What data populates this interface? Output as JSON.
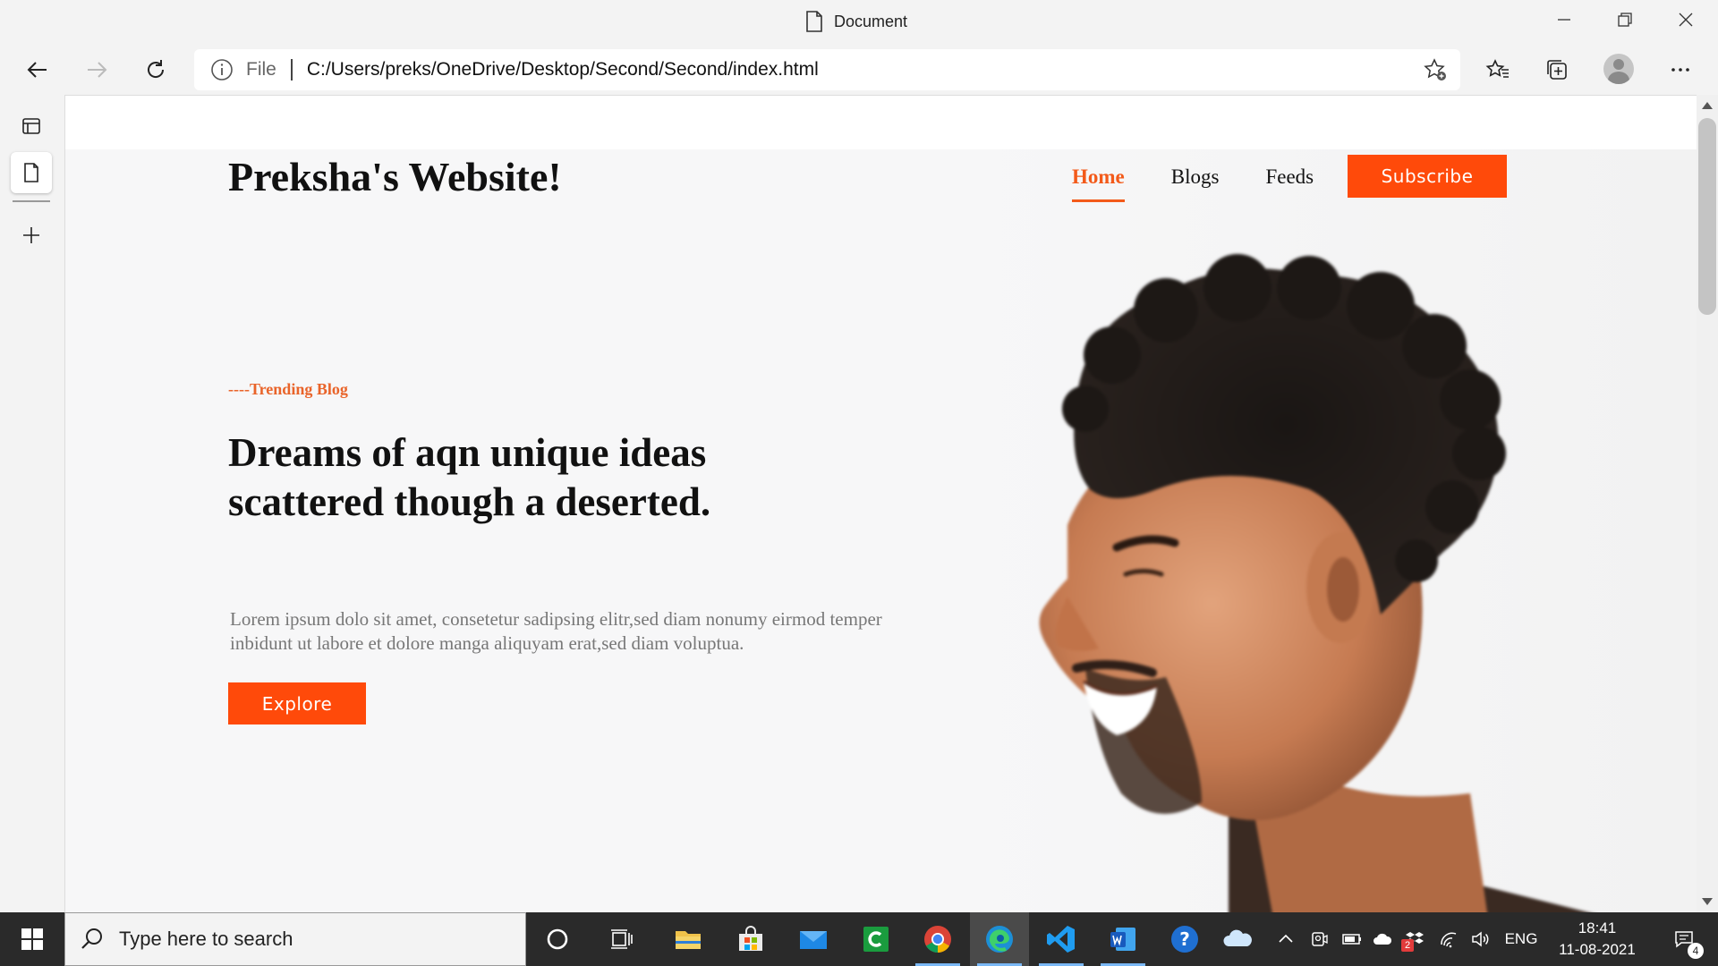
{
  "window": {
    "title": "Document",
    "icons": {
      "doc": "document-icon",
      "minimize": "minimize-icon",
      "restore": "restore-icon",
      "close": "close-icon"
    }
  },
  "toolbar": {
    "file_label": "File",
    "url": "C:/Users/preks/OneDrive/Desktop/Second/Second/index.html",
    "icons": [
      "back-icon",
      "forward-icon",
      "refresh-icon",
      "info-icon",
      "add-favorite-icon",
      "favorites-icon",
      "collections-icon",
      "profile-avatar",
      "more-icon"
    ]
  },
  "vertical_tabs": {
    "icons": [
      "tab-actions-icon",
      "document-tab-icon",
      "new-tab-icon"
    ]
  },
  "site": {
    "logo": "Preksha's Website!",
    "nav": [
      {
        "label": "Home",
        "active": true
      },
      {
        "label": "Blogs",
        "active": false
      },
      {
        "label": "Feeds",
        "active": false
      }
    ],
    "subscribe": "Subscribe",
    "trending": "----Trending Blog",
    "headline": "Dreams of aqn unique ideas scattered though a deserted.",
    "body": "Lorem ipsum dolo sit amet, consetetur sadipsing elitr,sed diam nonumy eirmod temper inbidunt ut labore et dolore manga aliquyam erat,sed diam voluptua.",
    "explore": "Explore",
    "accent": "#ff4a0a",
    "hero_image": "smiling-man-portrait"
  },
  "taskbar": {
    "search_placeholder": "Type here to search",
    "apps": [
      "cortana-icon",
      "task-view-icon",
      "file-explorer-icon",
      "store-icon",
      "mail-icon",
      "utorrent-icon",
      "chrome-icon",
      "edge-icon",
      "vscode-icon",
      "word-icon",
      "help-icon",
      "onedrive-icon"
    ],
    "tray": {
      "language": "ENG",
      "time": "18:41",
      "date": "11-08-2021",
      "notification_count": "4",
      "dropbox_badge": "2"
    }
  }
}
